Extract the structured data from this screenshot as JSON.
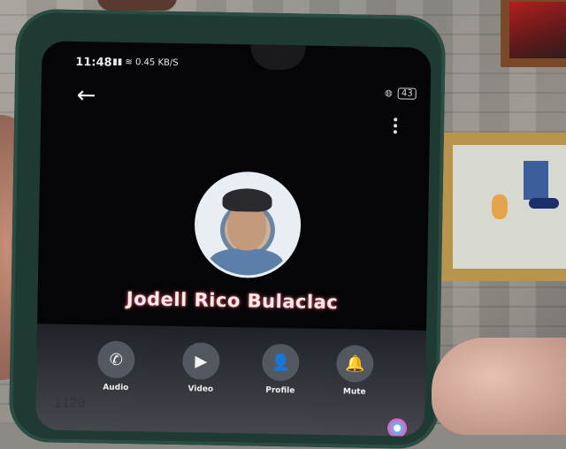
{
  "status_bar": {
    "time": "11:48",
    "network": "0.45 KB/S",
    "battery": "43"
  },
  "header": {
    "back_icon": "arrow-left-icon",
    "menu_icon": "vertical-dots-icon"
  },
  "contact": {
    "name": "Jodell Rico Bulaclac"
  },
  "actions": [
    {
      "label": "Audio",
      "icon": "phone-icon",
      "glyph": "✆"
    },
    {
      "label": "Video",
      "icon": "video-camera-icon",
      "glyph": "▶"
    },
    {
      "label": "Profile",
      "icon": "person-icon",
      "glyph": "👤"
    },
    {
      "label": "Mute",
      "icon": "bell-icon",
      "glyph": "🔔"
    }
  ],
  "reflection": "1120"
}
